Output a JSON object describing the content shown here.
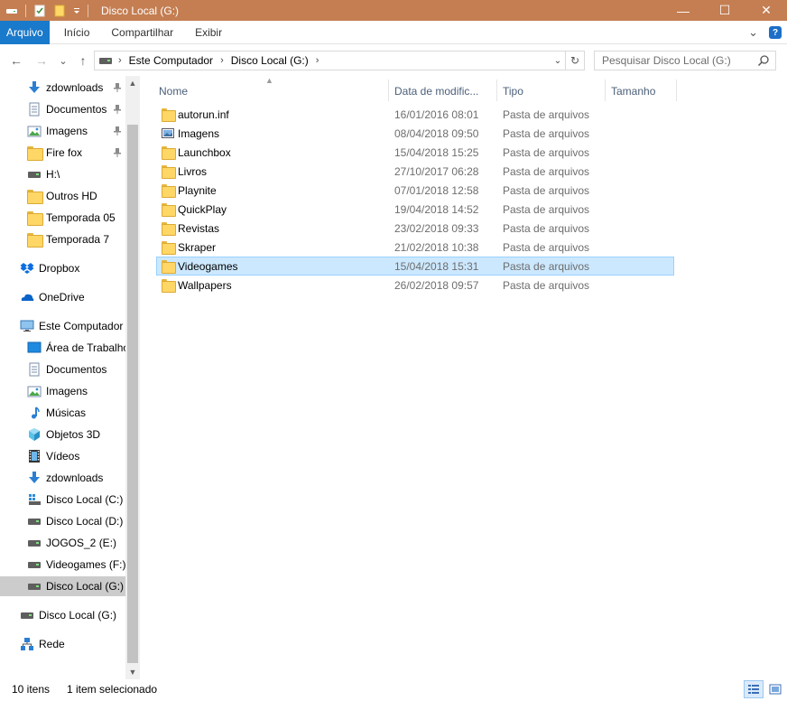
{
  "window": {
    "title": "Disco Local (G:)",
    "controls": {
      "minimize": "—",
      "maximize": "☐",
      "close": "✕"
    }
  },
  "ribbon": {
    "tabs": [
      "Arquivo",
      "Início",
      "Compartilhar",
      "Exibir"
    ],
    "help": "?",
    "expand_glyph": "⌄"
  },
  "nav": {
    "back": "←",
    "forward": "→",
    "recent": "⌄",
    "up": "↑"
  },
  "address": {
    "crumbs": [
      "Este Computador",
      "Disco Local (G:)"
    ],
    "separator": "›",
    "dropdown_glyph": "⌄",
    "refresh_glyph": "↻"
  },
  "search": {
    "placeholder": "Pesquisar Disco Local (G:)"
  },
  "sidebar": {
    "items": [
      {
        "label": "zdownloads",
        "icon": "download-arrow-icon",
        "pinned": true
      },
      {
        "label": "Documentos",
        "icon": "document-icon",
        "pinned": true
      },
      {
        "label": "Imagens",
        "icon": "pictures-icon",
        "pinned": true
      },
      {
        "label": "Fire fox",
        "icon": "folder-icon",
        "pinned": true
      },
      {
        "label": "H:\\",
        "icon": "drive-icon",
        "pinned": false
      },
      {
        "label": "Outros HD",
        "icon": "folder-icon",
        "pinned": false
      },
      {
        "label": "Temporada 05",
        "icon": "folder-icon",
        "pinned": false
      },
      {
        "label": "Temporada 7",
        "icon": "folder-icon",
        "pinned": false
      },
      {
        "label": "Dropbox",
        "icon": "dropbox-icon",
        "pinned": false
      },
      {
        "label": "OneDrive",
        "icon": "onedrive-icon",
        "pinned": false
      },
      {
        "label": "Este Computador",
        "icon": "computer-icon",
        "pinned": false
      },
      {
        "label": "Área de Trabalho",
        "icon": "desktop-icon",
        "pinned": false
      },
      {
        "label": "Documentos",
        "icon": "document-icon",
        "pinned": false
      },
      {
        "label": "Imagens",
        "icon": "pictures-icon",
        "pinned": false
      },
      {
        "label": "Músicas",
        "icon": "music-note-icon",
        "pinned": false
      },
      {
        "label": "Objetos 3D",
        "icon": "cube-3d-icon",
        "pinned": false
      },
      {
        "label": "Vídeos",
        "icon": "film-icon",
        "pinned": false
      },
      {
        "label": "zdownloads",
        "icon": "download-arrow-icon",
        "pinned": false
      },
      {
        "label": "Disco Local (C:)",
        "icon": "windows-drive-icon",
        "pinned": false
      },
      {
        "label": "Disco Local (D:)",
        "icon": "drive-icon",
        "pinned": false
      },
      {
        "label": "JOGOS_2 (E:)",
        "icon": "drive-icon",
        "pinned": false
      },
      {
        "label": "Videogames (F:)",
        "icon": "drive-icon",
        "pinned": false
      },
      {
        "label": "Disco Local (G:)",
        "icon": "drive-icon",
        "pinned": false,
        "selected": true
      },
      {
        "label": "Disco Local (G:)",
        "icon": "drive-icon",
        "pinned": false
      },
      {
        "label": "Rede",
        "icon": "network-icon",
        "pinned": false
      }
    ],
    "pin_glyph": "📌",
    "scroll_up": "▲",
    "scroll_down": "▼"
  },
  "columns": {
    "name": "Nome",
    "date": "Data de modific...",
    "type": "Tipo",
    "size": "Tamanho",
    "sort_glyph": "▲"
  },
  "files": [
    {
      "name": "autorun.inf",
      "date": "16/01/2016 08:01",
      "type": "Pasta de arquivos",
      "icon": "folder-icon"
    },
    {
      "name": "Imagens",
      "date": "08/04/2018 09:50",
      "type": "Pasta de arquivos",
      "icon": "pictures-folder-icon"
    },
    {
      "name": "Launchbox",
      "date": "15/04/2018 15:25",
      "type": "Pasta de arquivos",
      "icon": "folder-icon"
    },
    {
      "name": "Livros",
      "date": "27/10/2017 06:28",
      "type": "Pasta de arquivos",
      "icon": "folder-icon"
    },
    {
      "name": "Playnite",
      "date": "07/01/2018 12:58",
      "type": "Pasta de arquivos",
      "icon": "folder-icon"
    },
    {
      "name": "QuickPlay",
      "date": "19/04/2018 14:52",
      "type": "Pasta de arquivos",
      "icon": "folder-icon"
    },
    {
      "name": "Revistas",
      "date": "23/02/2018 09:33",
      "type": "Pasta de arquivos",
      "icon": "folder-icon"
    },
    {
      "name": "Skraper",
      "date": "21/02/2018 10:38",
      "type": "Pasta de arquivos",
      "icon": "folder-icon"
    },
    {
      "name": "Videogames",
      "date": "15/04/2018 15:31",
      "type": "Pasta de arquivos",
      "icon": "folder-icon",
      "selected": true
    },
    {
      "name": "Wallpapers",
      "date": "26/02/2018 09:57",
      "type": "Pasta de arquivos",
      "icon": "folder-icon"
    }
  ],
  "status": {
    "count": "10 itens",
    "selection": "1 item selecionado"
  },
  "colors": {
    "titlebar": "#c47e52",
    "file_tab": "#1979ca",
    "selection": "#cce8ff",
    "sidebar_selection": "#cccccc",
    "header_text": "#4c607a"
  }
}
